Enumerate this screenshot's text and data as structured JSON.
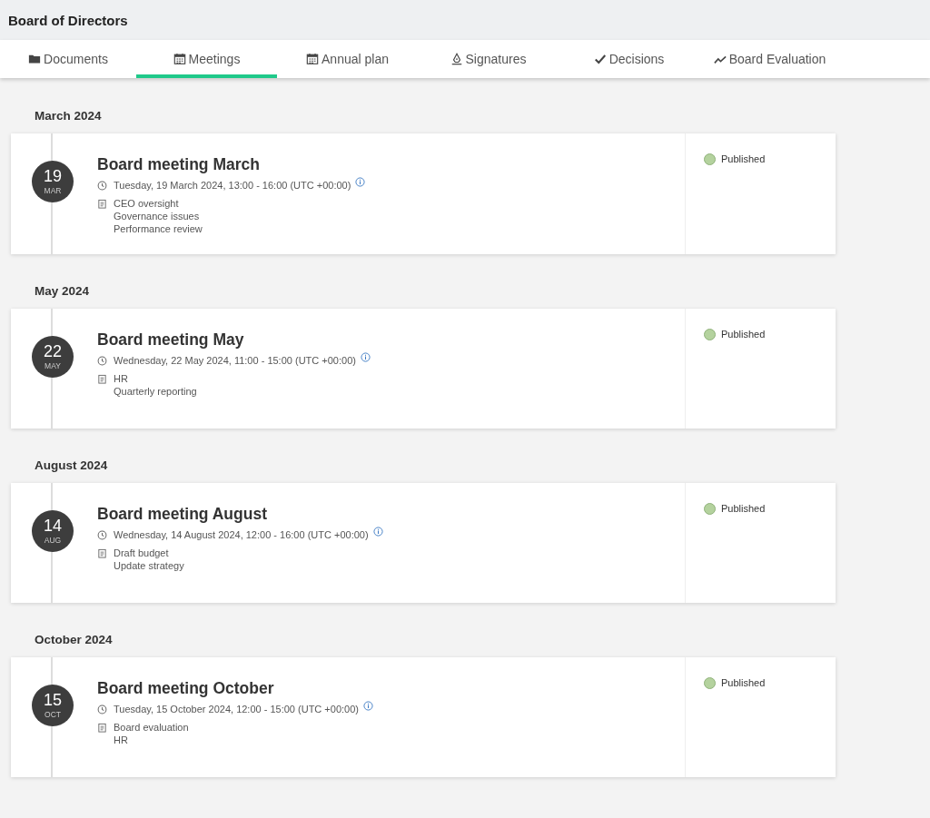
{
  "header": {
    "title": "Board of Directors"
  },
  "tabs": [
    {
      "label": "Documents",
      "kind": "folder",
      "selected": false
    },
    {
      "label": "Meetings",
      "kind": "calendar",
      "selected": true
    },
    {
      "label": "Annual plan",
      "kind": "calendar",
      "selected": false
    },
    {
      "label": "Signatures",
      "kind": "pen",
      "selected": false
    },
    {
      "label": "Decisions",
      "kind": "check",
      "selected": false
    },
    {
      "label": "Board Evaluation",
      "kind": "trend",
      "selected": false
    }
  ],
  "groups": [
    {
      "month": "March 2024",
      "meetings": [
        {
          "day": "19",
          "mon": "MAR",
          "title": "Board meeting March",
          "time": "Tuesday, 19 March 2024, 13:00 - 16:00 (UTC +00:00)",
          "agenda": [
            "CEO oversight",
            "Governance issues",
            "Performance review"
          ],
          "status": {
            "label": "Published",
            "color": "#b4d29e"
          }
        }
      ]
    },
    {
      "month": "May 2024",
      "meetings": [
        {
          "day": "22",
          "mon": "MAY",
          "title": "Board meeting May",
          "time": "Wednesday, 22 May 2024, 11:00 - 15:00 (UTC +00:00)",
          "agenda": [
            "HR",
            "Quarterly reporting"
          ],
          "status": {
            "label": "Published",
            "color": "#b4d29e"
          }
        }
      ]
    },
    {
      "month": "August 2024",
      "meetings": [
        {
          "day": "14",
          "mon": "AUG",
          "title": "Board meeting August",
          "time": "Wednesday, 14 August 2024, 12:00 - 16:00 (UTC +00:00)",
          "agenda": [
            "Draft budget",
            "Update strategy"
          ],
          "status": {
            "label": "Published",
            "color": "#b4d29e"
          }
        }
      ]
    },
    {
      "month": "October 2024",
      "meetings": [
        {
          "day": "15",
          "mon": "OCT",
          "title": "Board meeting October",
          "time": "Tuesday, 15 October 2024, 12:00 - 15:00 (UTC +00:00)",
          "agenda": [
            "Board evaluation",
            "HR"
          ],
          "status": {
            "label": "Published",
            "color": "#b4d29e"
          }
        }
      ]
    }
  ]
}
